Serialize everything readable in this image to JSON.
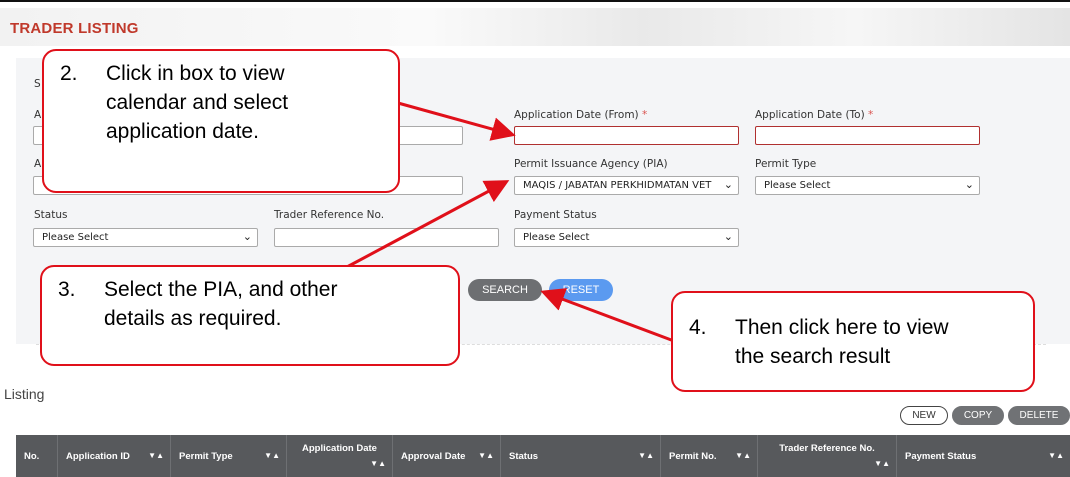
{
  "page": {
    "title": "TRADER LISTING"
  },
  "search_form": {
    "partial_label_1": "S",
    "partial_label_2": "A",
    "partial_label_3": "A",
    "app_date_from_label": "Application Date (From)",
    "app_date_to_label": "Application Date (To)",
    "required_marker": "*",
    "pia_label": "Permit Issuance Agency (PIA)",
    "pia_value": "MAQIS / JABATAN PERKHIDMATAN VET",
    "permit_type_label": "Permit Type",
    "permit_type_value": "Please Select",
    "status_label": "Status",
    "status_value": "Please Select",
    "trader_ref_label": "Trader Reference No.",
    "payment_status_label": "Payment Status",
    "payment_status_value": "Please Select",
    "search_label": "SEARCH",
    "reset_label": "RESET"
  },
  "listing": {
    "title": "Listing",
    "new_label": "NEW",
    "copy_label": "COPY",
    "delete_label": "DELETE",
    "sort_icon": "▼▲",
    "sort_up_icon": "▼▲",
    "columns": [
      "No.",
      "Application ID",
      "Permit Type",
      "Application Date",
      "Approval Date",
      "Status",
      "Permit No.",
      "Trader Reference No.",
      "Payment Status"
    ]
  },
  "callouts": [
    {
      "num": "2.",
      "lines": [
        "Click in box to view",
        "calendar and select",
        "application date."
      ]
    },
    {
      "num": "3.",
      "lines": [
        "Select the PIA, and other",
        "details as required."
      ]
    },
    {
      "num": "4.",
      "lines": [
        "Then click here to view",
        "the search result"
      ]
    }
  ],
  "colors": {
    "title": "#c0392b",
    "callout_border": "#e0101a",
    "header_bg": "#57595c",
    "reset": "#5b9af0"
  },
  "icons": {
    "chevron": "chevron-down-icon",
    "sort": "sort-icon"
  }
}
